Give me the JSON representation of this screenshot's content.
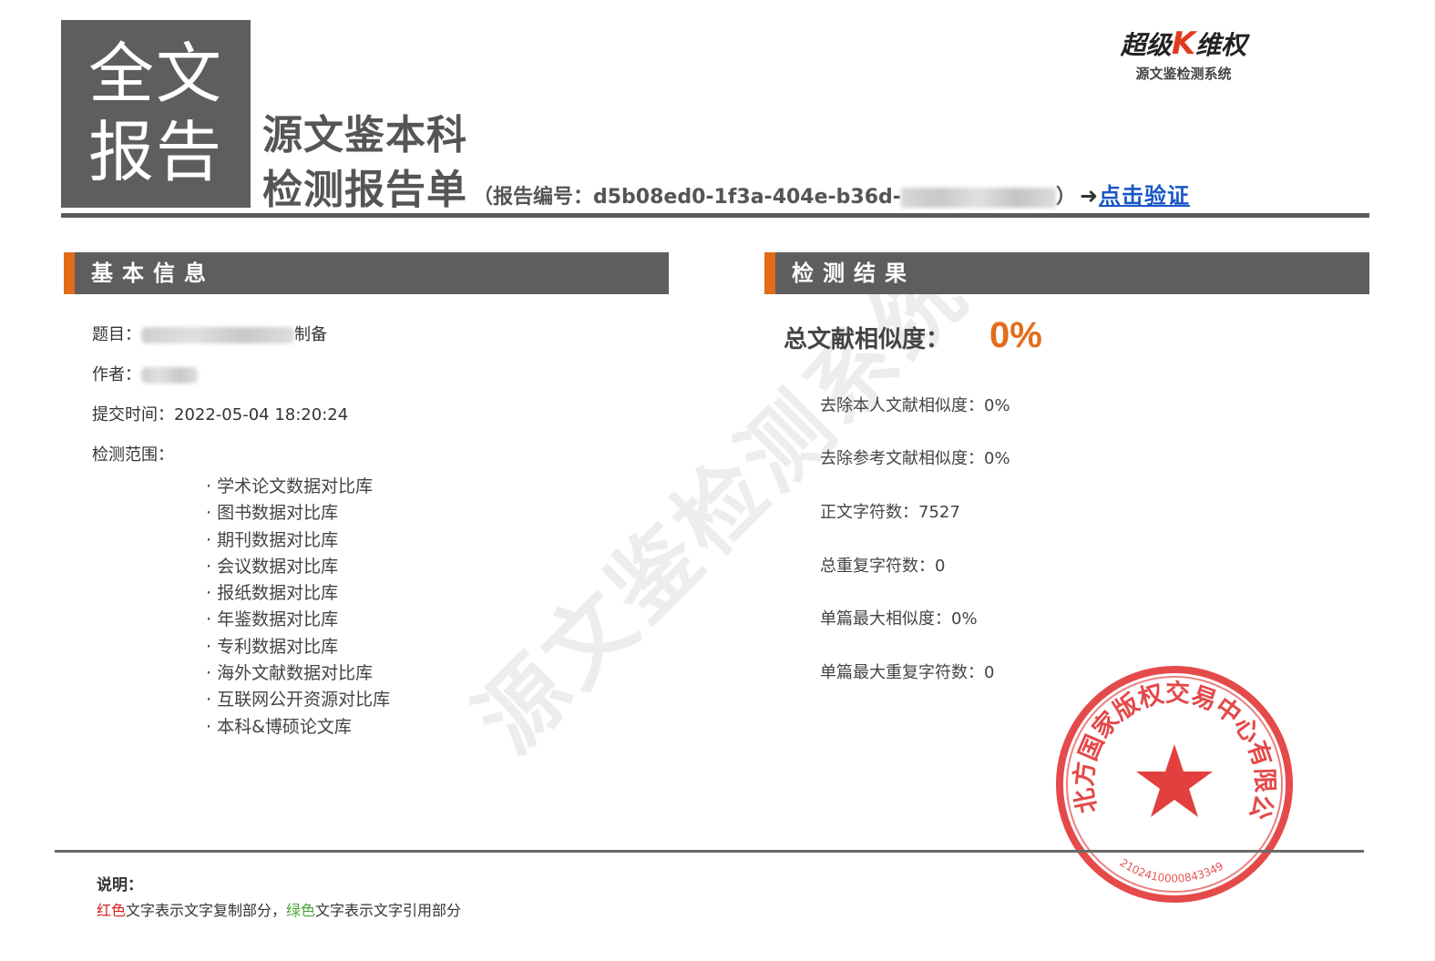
{
  "badge": {
    "line1": "全文",
    "line2": "报告"
  },
  "header": {
    "title_line1": "源文鉴本科",
    "title_line2": "检测报告单",
    "report_no_prefix": "（报告编号：d5b08ed0-1f3a-404e-b36d-",
    "report_no_suffix": "）",
    "arrow": "➜",
    "verify_link": "点击验证"
  },
  "logo": {
    "main_left": "超级",
    "main_k": "K",
    "main_right": "维权",
    "sub": "源文鉴检测系统"
  },
  "basic_info": {
    "header": "基本信息",
    "title_label": "题目：",
    "title_tail": "制备",
    "author_label": "作者：",
    "submit_time": "提交时间：2022-05-04 18:20:24",
    "scope_label": "检测范围：",
    "scope_items": [
      "学术论文数据对比库",
      "图书数据对比库",
      "期刊数据对比库",
      "会议数据对比库",
      "报纸数据对比库",
      "年鉴数据对比库",
      "专利数据对比库",
      "海外文献数据对比库",
      "互联网公开资源对比库",
      "本科&博硕论文库"
    ]
  },
  "results": {
    "header": "检测结果",
    "total_label": "总文献相似度：",
    "total_value": "0%",
    "stats": [
      "去除本人文献相似度：0%",
      "去除参考文献相似度：0%",
      "正文字符数：7527",
      "总重复字符数：0",
      "单篇最大相似度：0%",
      "单篇最大重复字符数：0"
    ]
  },
  "note": {
    "title": "说明：",
    "red_word": "红色",
    "red_text": "文字表示文字复制部分，",
    "green_word": "绿色",
    "green_text": "文字表示文字引用部分"
  },
  "watermark": "源文鉴检测系统",
  "seal": {
    "text": "北方国家版权交易中心有限公司",
    "number": "2102410000843349",
    "color": "#e02a2a"
  },
  "colors": {
    "accent": "#e36c1a",
    "header_bg": "#5e5e5e",
    "link": "#1a56c6"
  }
}
